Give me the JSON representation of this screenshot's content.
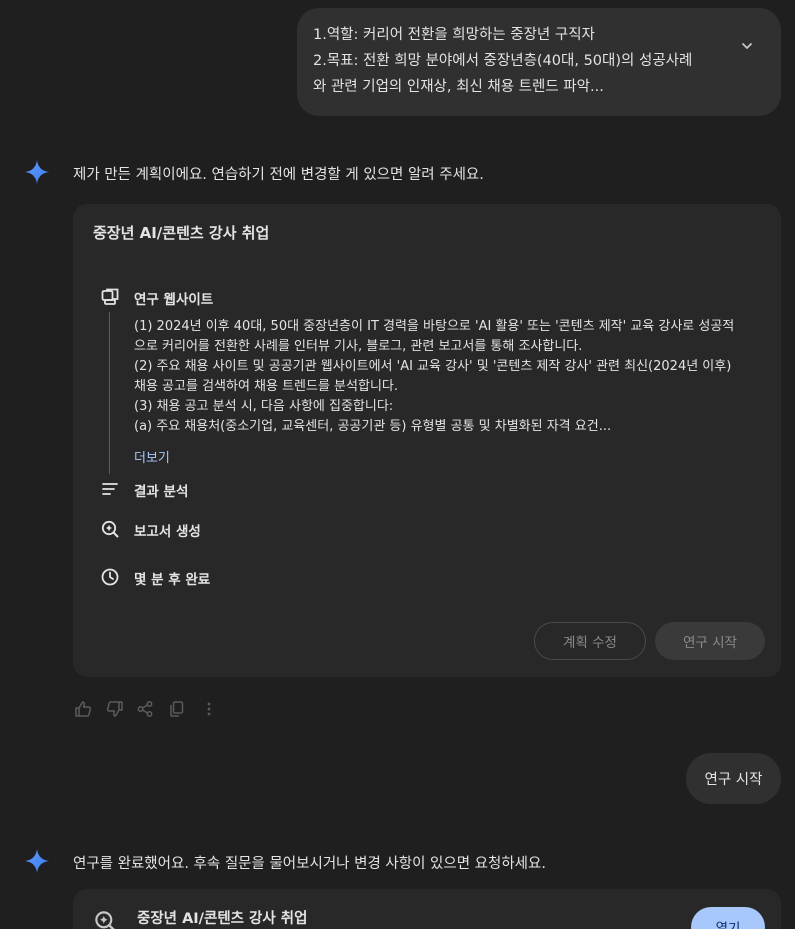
{
  "user_message_1": {
    "lines": [
      "1.역할: 커리어 전환을 희망하는 중장년 구직자",
      "2.목표: 전환 희망 분야에서 중장년층(40대, 50대)의 성공사례",
      "와 관련 기업의 인재상, 최신 채용 트렌드 파악..."
    ],
    "expand_icon": "chevron-down-icon"
  },
  "model_message_1": "제가 만든 계획이에요. 연습하기 전에 변경할 게 있으면 알려 주세요.",
  "plan": {
    "title": "중장년 AI/콘텐츠 강사 취업",
    "steps": {
      "research": "연구 웹사이트",
      "analyze": "결과 분석",
      "report": "보고서 생성",
      "time": "몇 분 후 완료"
    },
    "description": [
      "(1) 2024년 이후 40대, 50대 중장년층이 IT 경력을 바탕으로 'AI 활용' 또는 '콘텐츠 제작' 교육 강사로 성공적",
      "으로 커리어를 전환한 사례를 인터뷰 기사, 블로그, 관련 보고서를 통해 조사합니다.",
      "(2) 주요 채용 사이트 및 공공기관 웹사이트에서 'AI 교육 강사' 및 '콘텐츠 제작 강사' 관련 최신(2024년 이후)",
      "채용 공고를 검색하여 채용 트렌드를 분석합니다.",
      "(3) 채용 공고 분석 시, 다음 사항에 집중합니다:",
      "(a) 주요 채용처(중소기업, 교육센터, 공공기관 등) 유형별 공통 및 차별화된 자격 요건..."
    ],
    "more_label": "더보기",
    "edit_button": "계획 수정",
    "start_button": "연구 시작"
  },
  "user_message_2": "연구 시작",
  "model_message_2": "연구를 완료했어요. 후속 질문을 물어보시거나 변경 사항이 있으면 요청하세요.",
  "report": {
    "title": "중장년 AI/콘텐츠 강사 취업",
    "open_button": "열기"
  },
  "colors": {
    "background": "#1f1f1f",
    "card": "#282828",
    "bubble": "#303030",
    "link": "#a8c7fa",
    "gemini_blue": "#4b8df8"
  }
}
